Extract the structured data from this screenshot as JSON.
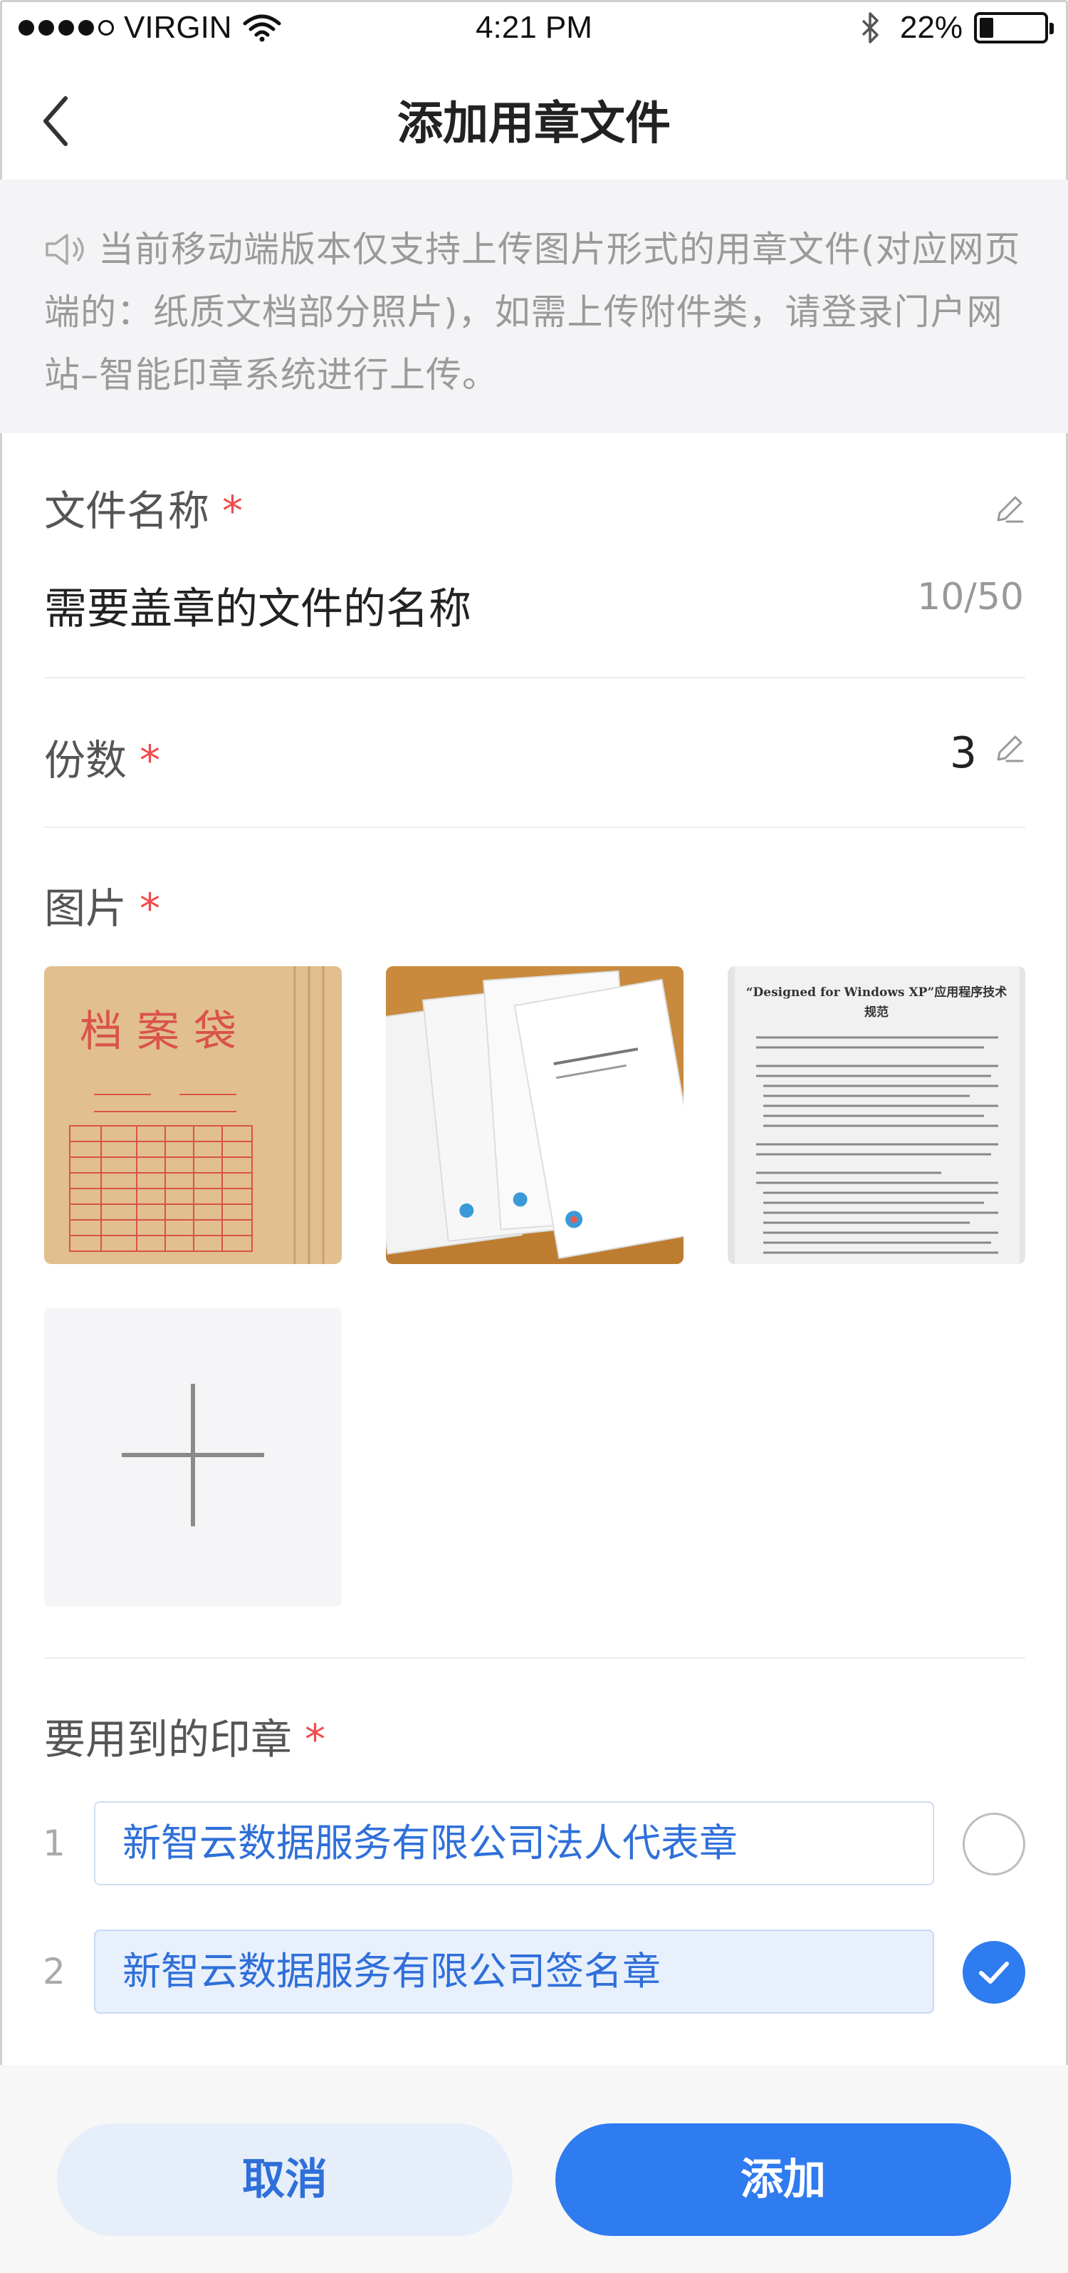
{
  "status_bar": {
    "carrier": "VIRGIN",
    "time": "4:21 PM",
    "battery": "22%",
    "battery_level": 0.22,
    "signal_bars_filled": 4,
    "signal_bars_total": 5
  },
  "nav": {
    "title": "添加用章文件"
  },
  "notice": {
    "text": "当前移动端版本仅支持上传图片形式的用章文件(对应网页端的：纸质文档部分照片)，如需上传附件类，请登录门户网站–智能印章系统进行上传。"
  },
  "form": {
    "file_name": {
      "label": "文件名称",
      "required_mark": "*",
      "value": "需要盖章的文件的名称",
      "counter": "10/50"
    },
    "copies": {
      "label": "份数",
      "required_mark": "*",
      "value": "3"
    },
    "images": {
      "label": "图片",
      "required_mark": "*",
      "thumb1": {
        "title": "档案袋"
      },
      "thumb3": {
        "title": "“Designed for Windows XP”应用程序技术",
        "subtitle": "规范"
      }
    },
    "seals": {
      "label": "要用到的印章",
      "required_mark": "*",
      "items": [
        {
          "index": "1",
          "name": "新智云数据服务有限公司法人代表章",
          "selected": false
        },
        {
          "index": "2",
          "name": "新智云数据服务有限公司签名章",
          "selected": true
        }
      ]
    }
  },
  "footer": {
    "cancel_label": "取消",
    "add_label": "添加"
  },
  "colors": {
    "accent": "#2f7bf0",
    "required": "#f04b4b",
    "seal_text": "#2f6fd9"
  },
  "icons": {
    "back": "chevron-left-icon",
    "speaker": "speaker-icon",
    "edit": "pencil-icon",
    "add": "plus-icon",
    "check": "check-icon"
  }
}
